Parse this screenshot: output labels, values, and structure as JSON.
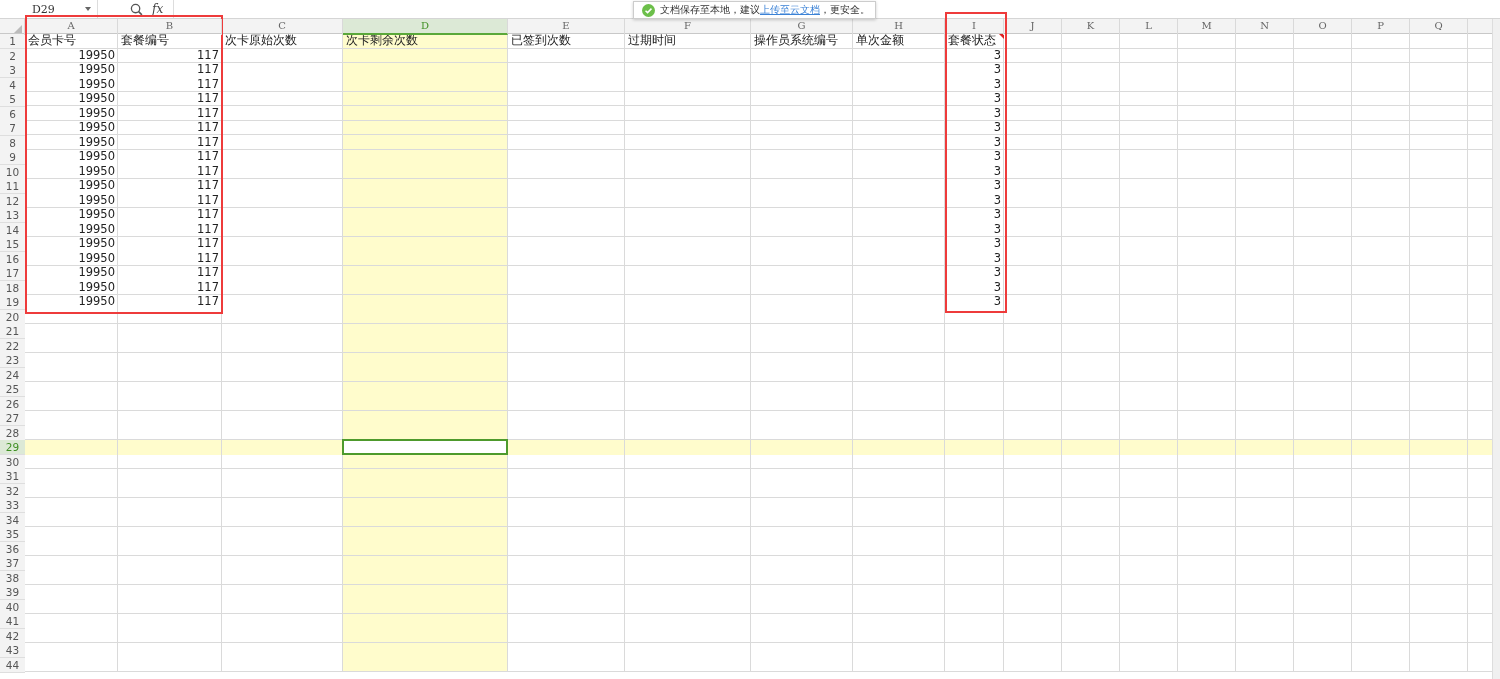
{
  "formula_bar": {
    "name_box": "D29",
    "fx_label": "fx"
  },
  "toast": {
    "message": "文档保存至本地，建议",
    "link": "上传至云文档",
    "suffix": "，更安全。"
  },
  "sheet": {
    "columns": [
      {
        "letter": "A",
        "selected": false
      },
      {
        "letter": "B",
        "selected": false
      },
      {
        "letter": "C",
        "selected": false
      },
      {
        "letter": "D",
        "selected": true
      },
      {
        "letter": "E",
        "selected": false
      },
      {
        "letter": "F",
        "selected": false
      },
      {
        "letter": "G",
        "selected": false
      },
      {
        "letter": "H",
        "selected": false
      },
      {
        "letter": "I",
        "selected": false
      },
      {
        "letter": "J",
        "selected": false
      },
      {
        "letter": "K",
        "selected": false
      },
      {
        "letter": "L",
        "selected": false
      },
      {
        "letter": "M",
        "selected": false
      },
      {
        "letter": "N",
        "selected": false
      },
      {
        "letter": "O",
        "selected": false
      },
      {
        "letter": "P",
        "selected": false
      },
      {
        "letter": "Q",
        "selected": false
      }
    ],
    "rows": [
      {
        "number": "1",
        "selected": false,
        "kind": "header",
        "cells": [
          {
            "text": "会员卡号",
            "note": false
          },
          {
            "text": "套餐编号",
            "note": false
          },
          {
            "text": "次卡原始次数",
            "note": false
          },
          {
            "text": "次卡剩余次数",
            "note": false
          },
          {
            "text": "已签到次数",
            "note": false
          },
          {
            "text": "过期时间",
            "note": false
          },
          {
            "text": "操作员系统编号",
            "note": false
          },
          {
            "text": "单次金额",
            "note": false
          },
          {
            "text": "套餐状态",
            "note": true
          }
        ]
      },
      {
        "number": "2",
        "selected": false,
        "kind": "data",
        "cells": [
          "19950",
          "117",
          null,
          null,
          null,
          null,
          null,
          null,
          "3"
        ]
      },
      {
        "number": "3",
        "selected": false,
        "kind": "data",
        "cells": [
          "19950",
          "117",
          null,
          null,
          null,
          null,
          null,
          null,
          "3"
        ]
      },
      {
        "number": "4",
        "selected": false,
        "kind": "data",
        "cells": [
          "19950",
          "117",
          null,
          null,
          null,
          null,
          null,
          null,
          "3"
        ]
      },
      {
        "number": "5",
        "selected": false,
        "kind": "data",
        "cells": [
          "19950",
          "117",
          null,
          null,
          null,
          null,
          null,
          null,
          "3"
        ]
      },
      {
        "number": "6",
        "selected": false,
        "kind": "data",
        "cells": [
          "19950",
          "117",
          null,
          null,
          null,
          null,
          null,
          null,
          "3"
        ]
      },
      {
        "number": "7",
        "selected": false,
        "kind": "data",
        "cells": [
          "19950",
          "117",
          null,
          null,
          null,
          null,
          null,
          null,
          "3"
        ]
      },
      {
        "number": "8",
        "selected": false,
        "kind": "data",
        "cells": [
          "19950",
          "117",
          null,
          null,
          null,
          null,
          null,
          null,
          "3"
        ]
      },
      {
        "number": "9",
        "selected": false,
        "kind": "data",
        "cells": [
          "19950",
          "117",
          null,
          null,
          null,
          null,
          null,
          null,
          "3"
        ]
      },
      {
        "number": "10",
        "selected": false,
        "kind": "data",
        "cells": [
          "19950",
          "117",
          null,
          null,
          null,
          null,
          null,
          null,
          "3"
        ]
      },
      {
        "number": "11",
        "selected": false,
        "kind": "data",
        "cells": [
          "19950",
          "117",
          null,
          null,
          null,
          null,
          null,
          null,
          "3"
        ]
      },
      {
        "number": "12",
        "selected": false,
        "kind": "data",
        "cells": [
          "19950",
          "117",
          null,
          null,
          null,
          null,
          null,
          null,
          "3"
        ]
      },
      {
        "number": "13",
        "selected": false,
        "kind": "data",
        "cells": [
          "19950",
          "117",
          null,
          null,
          null,
          null,
          null,
          null,
          "3"
        ]
      },
      {
        "number": "14",
        "selected": false,
        "kind": "data",
        "cells": [
          "19950",
          "117",
          null,
          null,
          null,
          null,
          null,
          null,
          "3"
        ]
      },
      {
        "number": "15",
        "selected": false,
        "kind": "data",
        "cells": [
          "19950",
          "117",
          null,
          null,
          null,
          null,
          null,
          null,
          "3"
        ]
      },
      {
        "number": "16",
        "selected": false,
        "kind": "data",
        "cells": [
          "19950",
          "117",
          null,
          null,
          null,
          null,
          null,
          null,
          "3"
        ]
      },
      {
        "number": "17",
        "selected": false,
        "kind": "data",
        "cells": [
          "19950",
          "117",
          null,
          null,
          null,
          null,
          null,
          null,
          "3"
        ]
      },
      {
        "number": "18",
        "selected": false,
        "kind": "data",
        "cells": [
          "19950",
          "117",
          null,
          null,
          null,
          null,
          null,
          null,
          "3"
        ]
      },
      {
        "number": "19",
        "selected": false,
        "kind": "data",
        "cells": [
          "19950",
          "117",
          null,
          null,
          null,
          null,
          null,
          null,
          "3"
        ]
      },
      {
        "number": "20",
        "selected": false
      },
      {
        "number": "21",
        "selected": false
      },
      {
        "number": "22",
        "selected": false
      },
      {
        "number": "23",
        "selected": false
      },
      {
        "number": "24",
        "selected": false
      },
      {
        "number": "25",
        "selected": false
      },
      {
        "number": "26",
        "selected": false
      },
      {
        "number": "27",
        "selected": false
      },
      {
        "number": "28",
        "selected": false
      },
      {
        "number": "29",
        "selected": true
      },
      {
        "number": "30",
        "selected": false
      },
      {
        "number": "31",
        "selected": false
      },
      {
        "number": "32",
        "selected": false
      },
      {
        "number": "33",
        "selected": false
      },
      {
        "number": "34",
        "selected": false
      },
      {
        "number": "35",
        "selected": false
      },
      {
        "number": "36",
        "selected": false
      },
      {
        "number": "37",
        "selected": false
      },
      {
        "number": "38",
        "selected": false
      },
      {
        "number": "39",
        "selected": false
      },
      {
        "number": "40",
        "selected": false
      },
      {
        "number": "41",
        "selected": false
      },
      {
        "number": "42",
        "selected": false
      },
      {
        "number": "43",
        "selected": false
      },
      {
        "number": "44",
        "selected": false
      }
    ]
  }
}
